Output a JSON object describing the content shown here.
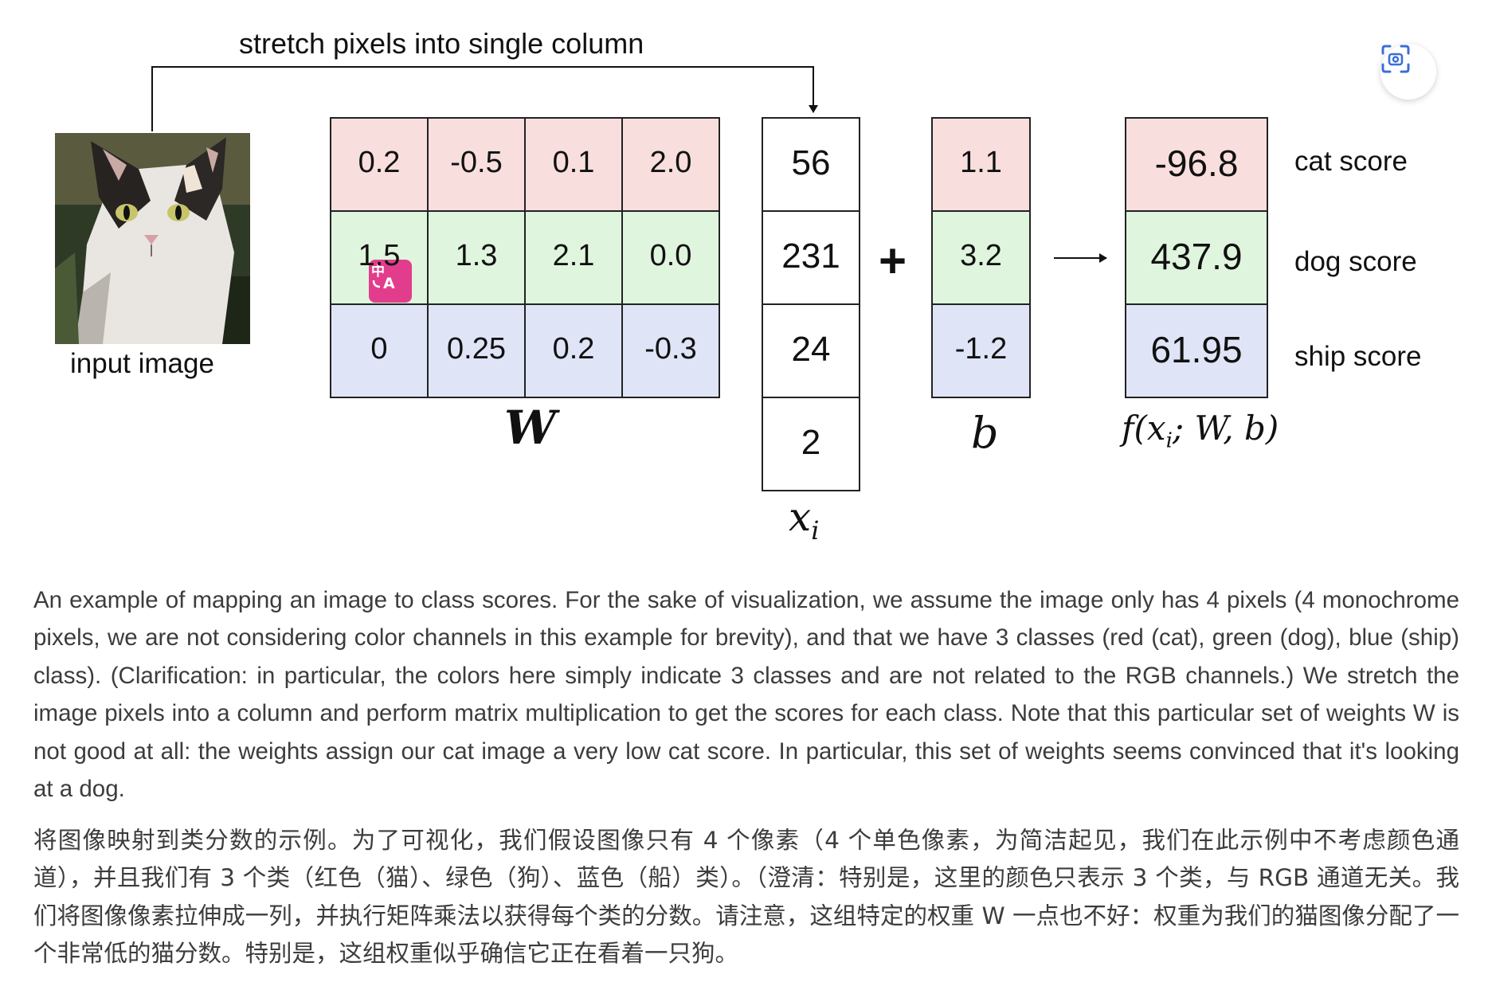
{
  "diagram": {
    "arrow_label": "stretch pixels into single column",
    "input_label": "input image",
    "W": {
      "symbol": "W",
      "rows": [
        [
          "0.2",
          "-0.5",
          "0.1",
          "2.0"
        ],
        [
          "1.5",
          "1.3",
          "2.1",
          "0.0"
        ],
        [
          "0",
          "0.25",
          "0.2",
          "-0.3"
        ]
      ]
    },
    "x": {
      "symbol": "x",
      "subscript": "i",
      "values": [
        "56",
        "231",
        "24",
        "2"
      ]
    },
    "plus": "+",
    "b": {
      "symbol": "b",
      "values": [
        "1.1",
        "3.2",
        "-1.2"
      ]
    },
    "f": {
      "symbol": "f(x",
      "sub": "i",
      "rest": "; W, b)",
      "values": [
        "-96.8",
        "437.9",
        "61.95"
      ]
    },
    "score_labels": [
      "cat score",
      "dog score",
      "ship score"
    ],
    "class_colors": {
      "cat": "#f9dede",
      "dog": "#dff5dd",
      "ship": "#dfe4f7"
    },
    "icons": {
      "scan": "scan-icon",
      "translate": "translate-icon"
    }
  },
  "captions": {
    "english": "An example of mapping an image to class scores. For the sake of visualization, we assume the image only has 4 pixels (4 monochrome pixels, we are not considering color channels in this example for brevity), and that we have 3 classes (red (cat), green (dog), blue (ship) class). (Clarification: in particular, the colors here simply indicate 3 classes and are not related to the RGB channels.) We stretch the image pixels into a column and perform matrix multiplication to get the scores for each class. Note that this particular set of weights W is not good at all: the weights assign our cat image a very low cat score. In particular, this set of weights seems convinced that it's looking at a dog.",
    "chinese": "将图像映射到类分数的示例。为了可视化，我们假设图像只有 4 个像素（4 个单色像素，为简洁起见，我们在此示例中不考虑颜色通道），并且我们有 3 个类（红色（猫）、绿色（狗）、蓝色（船）类）。（澄清：特别是，这里的颜色只表示 3 个类，与 RGB 通道无关。我们将图像像素拉伸成一列，并执行矩阵乘法以获得每个类的分数。请注意，这组特定的权重 W 一点也不好：权重为我们的猫图像分配了一个非常低的猫分数。特别是，这组权重似乎确信它正在看着一只狗。"
  }
}
